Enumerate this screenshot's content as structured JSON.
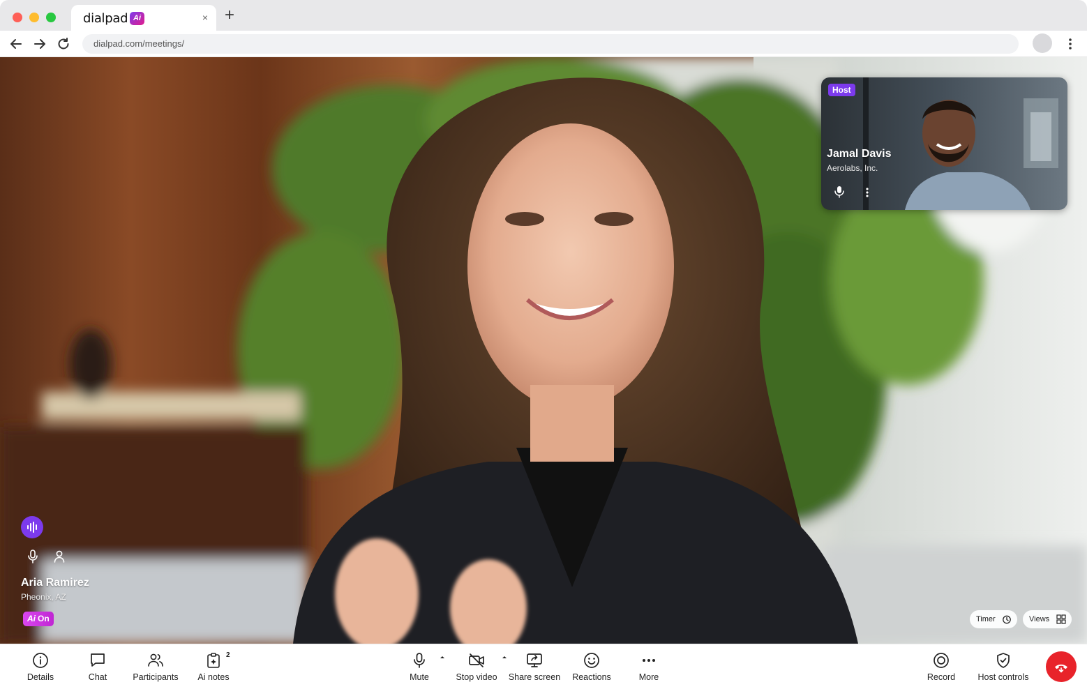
{
  "browser": {
    "tab": {
      "title": "dialpad",
      "badge": "Ai",
      "close_glyph": "×"
    },
    "new_tab_glyph": "+",
    "url": "dialpad.com/meetings/"
  },
  "meeting": {
    "participant_pip": {
      "badge": "Host",
      "name": "Jamal Davis",
      "subtitle": "Aerolabs, Inc."
    },
    "active_speaker": {
      "name": "Aria Ramirez",
      "location": "Pheonix, AZ",
      "ai_badge": {
        "glyph": "Ai",
        "label": "On"
      }
    },
    "overlay_controls": {
      "timer_label": "Timer",
      "views_label": "Views"
    }
  },
  "toolbar": {
    "left": [
      {
        "label": "Details",
        "icon": "info-icon"
      },
      {
        "label": "Chat",
        "icon": "chat-icon"
      },
      {
        "label": "Participants",
        "icon": "participants-icon"
      },
      {
        "label": "Ai notes",
        "icon": "ai-notes-icon",
        "count": "2"
      }
    ],
    "center": [
      {
        "label": "Mute",
        "icon": "microphone-icon"
      },
      {
        "label": "Stop video",
        "icon": "video-off-icon"
      },
      {
        "label": "Share screen",
        "icon": "share-screen-icon"
      },
      {
        "label": "Reactions",
        "icon": "smiley-icon"
      },
      {
        "label": "More",
        "icon": "more-horizontal-icon"
      }
    ],
    "right": [
      {
        "label": "Record",
        "icon": "record-icon"
      },
      {
        "label": "Host controls",
        "icon": "shield-check-icon"
      }
    ],
    "hangup_icon": "hang-up-icon"
  },
  "colors": {
    "brand_purple": "#7c3aed",
    "ai_magenta": "#d946ef",
    "hangup_red": "#e8232a",
    "traffic_red": "#fe5f57",
    "traffic_yellow": "#febc2e",
    "traffic_green": "#28c840"
  }
}
